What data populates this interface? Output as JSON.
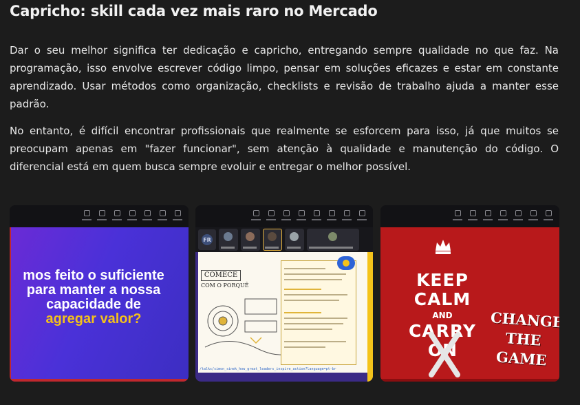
{
  "article": {
    "title": "Capricho: skill cada vez mais raro no Mercado",
    "paragraphs": [
      "Dar o seu melhor significa ter dedicação e capricho, entregando sempre qualidade no que faz. Na programação, isso envolve escrever código limpo, pensar em soluções eficazes e estar em constante aprendizado. Usar métodos como organização, checklists e revisão de trabalho ajuda a manter esse padrão.",
      "No entanto, é difícil encontrar profissionais que realmente se esforcem para isso, já que muitos se preocupam apenas em \"fazer funcionar\", sem atenção à qualidade e manutenção do código. O diferencial está em quem busca sempre evoluir e entregar o melhor possível."
    ]
  },
  "gallery": {
    "slide1": {
      "lines": [
        "mos feito o suficiente",
        "para manter a nossa",
        "capacidade de",
        "agregar valor?"
      ],
      "accent": "#f5c21a",
      "background": "#4a31d8"
    },
    "slide2": {
      "participant_initials": "FR",
      "heading": "COMECE",
      "subheading": "COM O PORQUÊ",
      "url": "/talks/simon_sinek_how_great_leaders_inspire_action?language=pt-br",
      "background": "#3b2a86"
    },
    "slide3": {
      "line1": "KEEP",
      "line2": "CALM",
      "line3": "AND",
      "line4": "CARRY",
      "line5": "ON",
      "change1": "CHANGE",
      "change2": "THE",
      "change3": "GAME",
      "background": "#b8191b"
    }
  }
}
